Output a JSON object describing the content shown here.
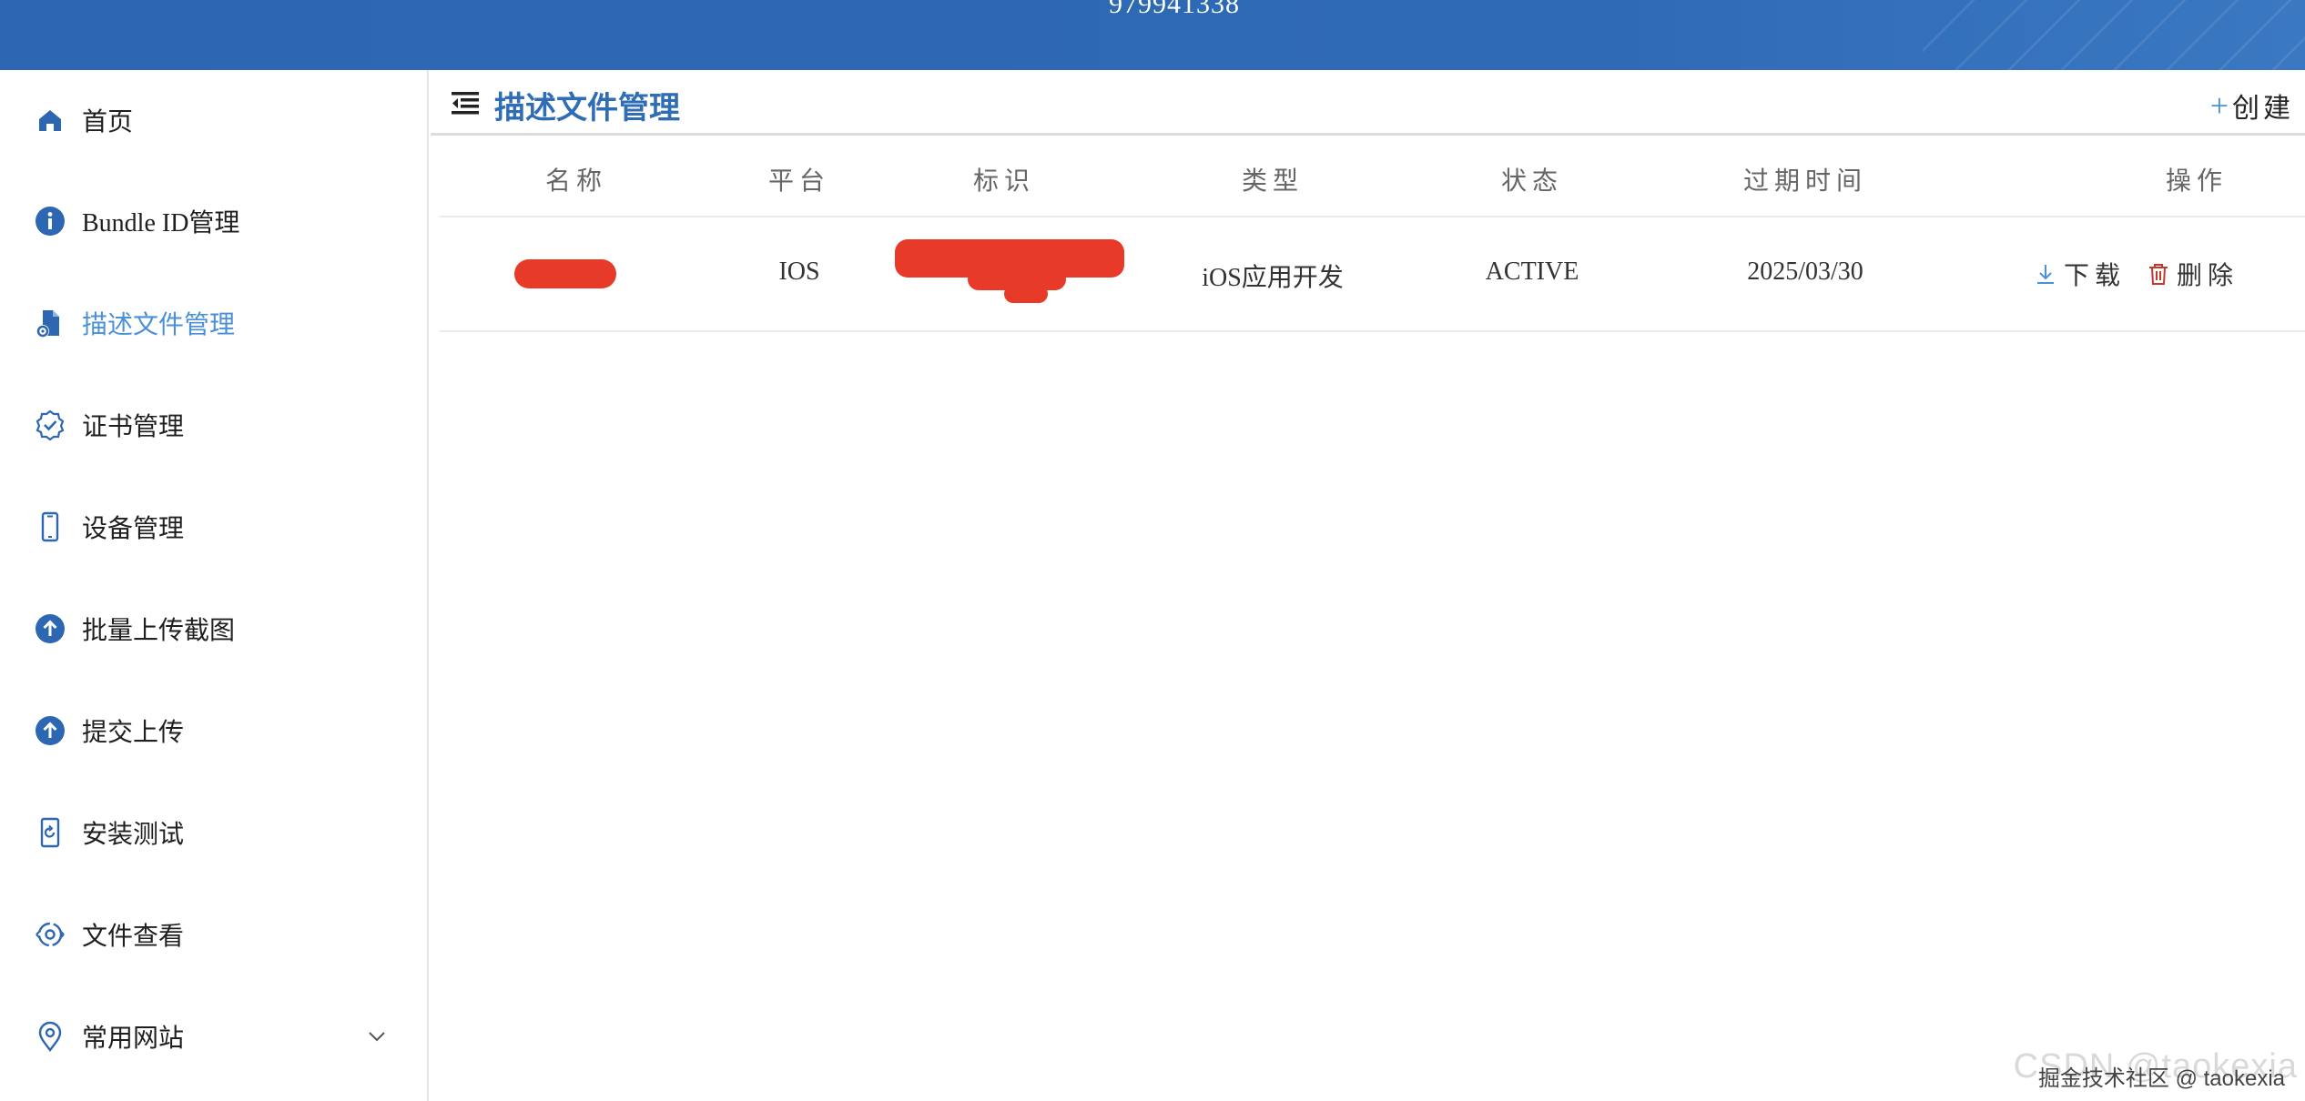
{
  "topbar": {
    "title": "979941338"
  },
  "sidebar": {
    "items": [
      {
        "label": "首页",
        "icon": "home-icon"
      },
      {
        "label": "Bundle ID管理",
        "icon": "info-icon"
      },
      {
        "label": "描述文件管理",
        "icon": "file-settings-icon",
        "active": true
      },
      {
        "label": "证书管理",
        "icon": "certificate-badge-icon"
      },
      {
        "label": "设备管理",
        "icon": "phone-icon"
      },
      {
        "label": "批量上传截图",
        "icon": "upload-icon"
      },
      {
        "label": "提交上传",
        "icon": "upload-icon"
      },
      {
        "label": "安装测试",
        "icon": "install-refresh-icon"
      },
      {
        "label": "文件查看",
        "icon": "file-view-icon"
      },
      {
        "label": "常用网站",
        "icon": "location-pin-icon",
        "expandable": true
      }
    ]
  },
  "header": {
    "title": "描述文件管理",
    "create_label": "创建",
    "create_icon": "+"
  },
  "table": {
    "columns": [
      "名称",
      "平台",
      "标识",
      "类型",
      "状态",
      "过期时间",
      "操作"
    ],
    "rows": [
      {
        "name": "",
        "platform": "IOS",
        "identifier": "",
        "type": "iOS应用开发",
        "status": "ACTIVE",
        "expires": "2025/03/30",
        "actions": {
          "download": "下载",
          "delete": "删除"
        }
      }
    ]
  },
  "watermark": {
    "back": "CSDN @taokexia",
    "front": "掘金技术社区 @ taokexia"
  },
  "colors": {
    "topbar": "#2f6ab6",
    "accent": "#4a90d9",
    "title": "#2f6db5",
    "delete": "#c0392b",
    "redaction": "#e83a28"
  }
}
